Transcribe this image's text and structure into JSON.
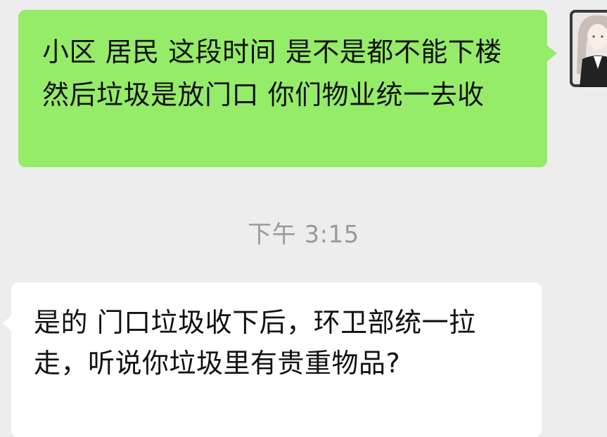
{
  "messages": [
    {
      "direction": "outgoing",
      "text": "小区 居民 这段时间 是不是都不能下楼 然后垃圾是放门口 你们物业统一去收"
    },
    {
      "direction": "incoming",
      "text": "是的 门口垃圾收下后，环卫部统一拉走，听说你垃圾里有贵重物品?"
    }
  ],
  "timestamp": "下午 3:15",
  "avatar": {
    "icon": "user-avatar-icon"
  },
  "colors": {
    "background": "#ededed",
    "outgoing_bubble": "#95ec69",
    "incoming_bubble": "#ffffff",
    "timestamp_text": "#9a9a9a"
  }
}
